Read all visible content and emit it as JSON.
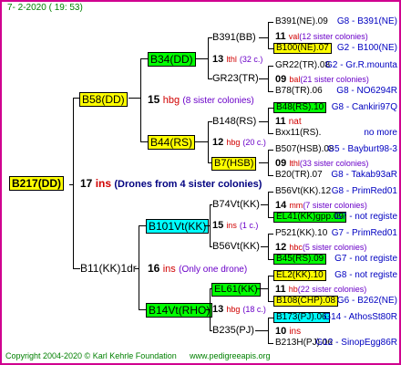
{
  "header": {
    "text": "7-  2-2020 ( 19: 53)"
  },
  "footer": {
    "copyright": "Copyright 2004-2020 © Karl Kehrle Foundation",
    "url": "www.pedigreeapis.org"
  },
  "root": {
    "id": "B217(DD)",
    "num": "17",
    "ins": "ins",
    "note": "(Drones from 4 sister colonies)"
  },
  "gen1": {
    "top": {
      "id": "B58(DD)",
      "num": "15",
      "ins": "hbg",
      "sub": "(8 sister colonies)"
    },
    "bottom": {
      "id": "B11(KK)1dr",
      "num": "16",
      "ins": "ins",
      "sub": "(Only one drone)"
    }
  },
  "gen2": {
    "a": {
      "id": "B34(DD)",
      "num": "13",
      "ins": "lthl",
      "sub": "(32 c.)"
    },
    "b": {
      "id": "B44(RS)",
      "num": "12",
      "ins": "hbg",
      "sub": "(20 c.)"
    },
    "c": {
      "id": "B101Vt(KK)",
      "num": "15",
      "ins": "ins",
      "sub": "(1 c.)"
    },
    "d": {
      "id": "B14Vt(RHO)",
      "num": "13",
      "ins": "hbg",
      "sub": "(18 c.)"
    }
  },
  "gen3": [
    {
      "id": "B391(BB)"
    },
    {
      "id": "GR23(TR)"
    },
    {
      "id": "B148(RS)"
    },
    {
      "id": "B7(HSB)"
    },
    {
      "id": "B74Vt(KK)"
    },
    {
      "id": "B56Vt(KK)"
    },
    {
      "id": "EL61(KK)"
    },
    {
      "id": "B235(PJ)"
    }
  ],
  "gen3_info": [
    {
      "num": "11",
      "ins": "val",
      "sub": "(12 sister colonies)"
    },
    {
      "num": "09",
      "ins": "bal",
      "sub": "(21 sister colonies)"
    },
    {
      "num": "11",
      "ins": "nat",
      "sub": ""
    },
    {
      "num": "09",
      "ins": "lthl",
      "sub": "(33 sister colonies)"
    },
    {
      "num": "14",
      "ins": "mm",
      "sub": "(7 sister colonies)"
    },
    {
      "num": "12",
      "ins": "hbc",
      "sub": "(5 sister colonies)"
    },
    {
      "num": "11",
      "ins": "hb",
      "sub": "(22 sister colonies)"
    },
    {
      "num": "10",
      "ins": "ins",
      "sub": ""
    }
  ],
  "gen4": [
    {
      "id": "B391(NE).09",
      "ref": "G8 - B391(NE)"
    },
    {
      "id": "B100(NE).07",
      "ref": "G2 - B100(NE)"
    },
    {
      "id": "GR22(TR).08",
      "ref": "G2 - Gr.R.mounta"
    },
    {
      "id": "B78(TR).06",
      "ref": "G8 - NO6294R"
    },
    {
      "id": "B48(RS).10",
      "ref": "G8 - Cankiri97Q"
    },
    {
      "id": "Bxx11(RS).",
      "ref": "no more"
    },
    {
      "id": "B507(HSB).08",
      "ref": "G5 - Bayburt98-3"
    },
    {
      "id": "B20(TR).07",
      "ref": "G8 - Takab93aR"
    },
    {
      "id": "B56Vt(KK).12",
      "ref": "G8 - PrimRed01"
    },
    {
      "id": "EL41(KK)gpp.09",
      "ref": "G7 - not registe"
    },
    {
      "id": "P521(KK).10",
      "ref": "G7 - PrimRed01"
    },
    {
      "id": "B45(RS).09",
      "ref": "G7 - not registe"
    },
    {
      "id": "EL2(KK).10",
      "ref": "G8 - not registe"
    },
    {
      "id": "B108(CHP).08",
      "ref": "G6 - B262(NE)"
    },
    {
      "id": "B173(PJ).06",
      "ref": "G14 - AthosSt80R"
    },
    {
      "id": "B213H(PJ).06",
      "ref": "G12 - SinopEgg86R"
    }
  ],
  "colors": {
    "frame": "#d0008f",
    "yellow": "#ffff00",
    "green": "#00ff00",
    "cyan": "#00ffff",
    "ins_red": "#d00000",
    "blue": "#0000c0"
  }
}
